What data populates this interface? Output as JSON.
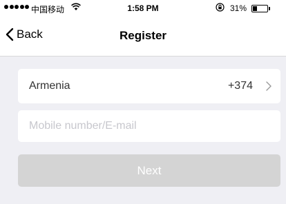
{
  "status_bar": {
    "signal_icon": "signal-dots-icon",
    "carrier": "中国移动",
    "wifi_icon": "wifi-icon",
    "time": "1:58 PM",
    "lock_icon": "rotation-lock-icon",
    "battery_percent": "31%",
    "battery_level": 0.31
  },
  "nav": {
    "back_icon": "chevron-left-icon",
    "back_label": "Back",
    "title": "Register"
  },
  "form": {
    "country_name": "Armenia",
    "country_code": "+374",
    "country_chevron_icon": "chevron-right-icon",
    "contact_placeholder": "Mobile number/E-mail",
    "contact_value": "",
    "next_label": "Next"
  },
  "colors": {
    "background": "#efeff4",
    "card": "#ffffff",
    "button_disabled": "#d4d4d4",
    "placeholder": "#c7c7cd"
  }
}
